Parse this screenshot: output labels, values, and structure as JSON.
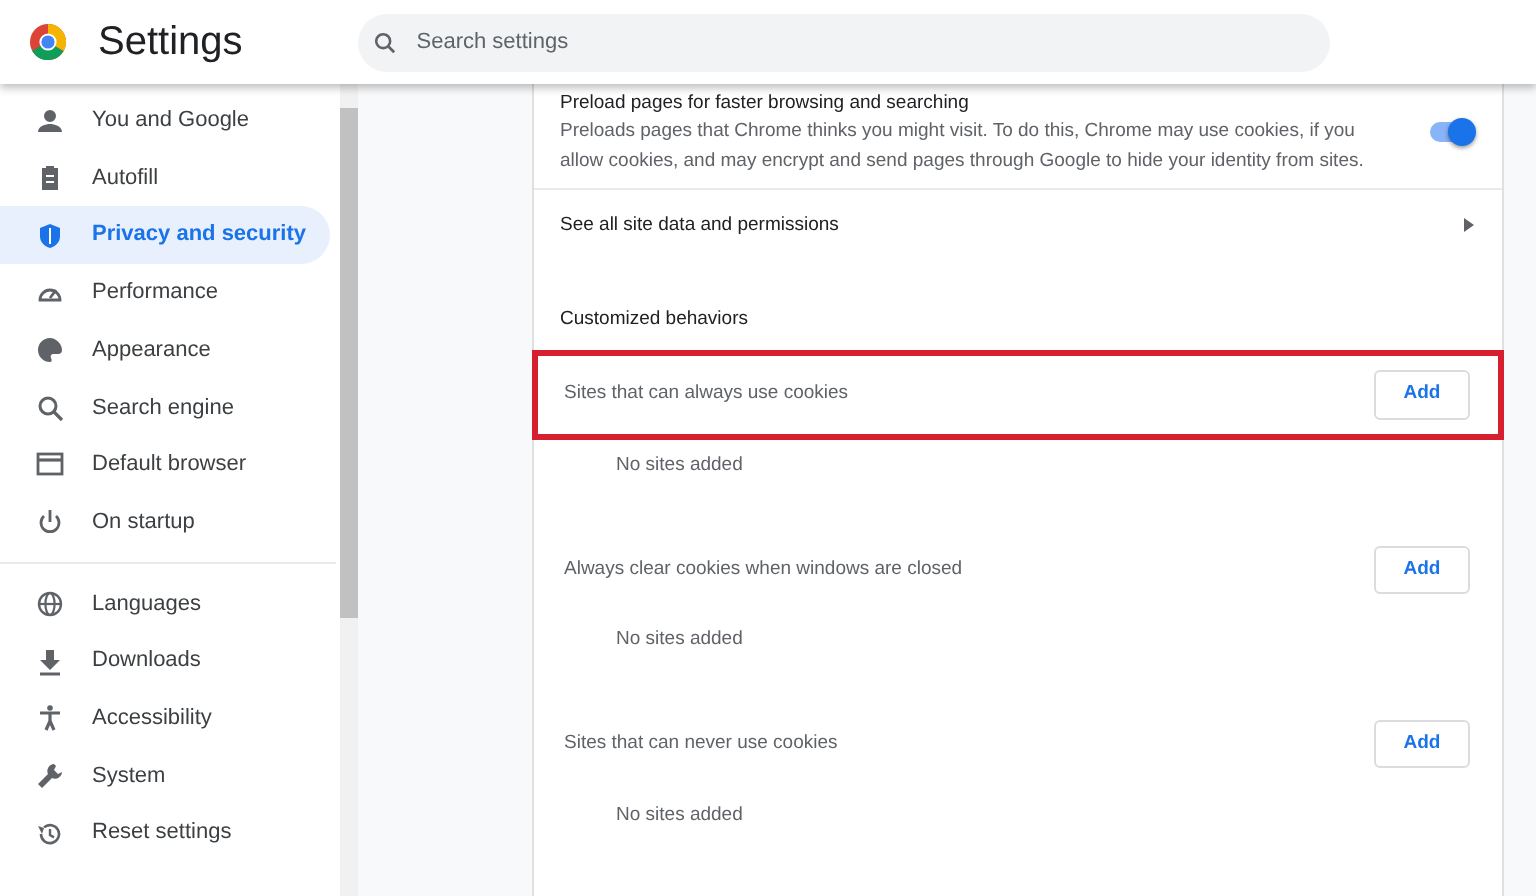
{
  "header": {
    "title": "Settings",
    "search": {
      "placeholder": "Search settings"
    }
  },
  "sidebar": {
    "groups": [
      [
        {
          "label": "You and Google",
          "selected": false
        },
        {
          "label": "Autofill",
          "selected": false
        },
        {
          "label": "Privacy and security",
          "selected": true
        },
        {
          "label": "Performance",
          "selected": false
        },
        {
          "label": "Appearance",
          "selected": false
        },
        {
          "label": "Search engine",
          "selected": false
        },
        {
          "label": "Default browser",
          "selected": false
        },
        {
          "label": "On startup",
          "selected": false
        }
      ],
      [
        {
          "label": "Languages",
          "selected": false
        },
        {
          "label": "Downloads",
          "selected": false
        },
        {
          "label": "Accessibility",
          "selected": false
        },
        {
          "label": "System",
          "selected": false
        },
        {
          "label": "Reset settings",
          "selected": false
        }
      ]
    ]
  },
  "preload": {
    "title": "Preload pages for faster browsing and searching",
    "description": "Preloads pages that Chrome thinks you might visit. To do this, Chrome may use cookies, if you allow cookies, and may encrypt and send pages through Google to hide your identity from sites.",
    "on": true
  },
  "site_data_link": "See all site data and permissions",
  "section_heading": "Customized behaviors",
  "behaviors": [
    {
      "label": "Sites that can always use cookies",
      "button": "Add",
      "empty_text": "No sites added",
      "highlighted": true
    },
    {
      "label": "Always clear cookies when windows are closed",
      "button": "Add",
      "empty_text": "No sites added",
      "highlighted": false
    },
    {
      "label": "Sites that can never use cookies",
      "button": "Add",
      "empty_text": "No sites added",
      "highlighted": false
    }
  ]
}
